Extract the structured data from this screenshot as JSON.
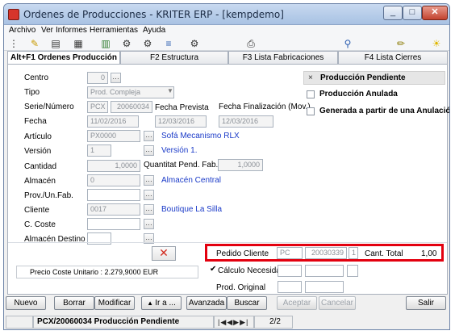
{
  "window": {
    "title": "Ordenes de Producciones - KRITER ERP - [kempdemo]"
  },
  "menu": [
    "Archivo",
    "Ver",
    "Informes",
    "Herramientas",
    "Ayuda"
  ],
  "toolbar_icons": [
    "tree-icon",
    "wand-icon",
    "document-search-icon",
    "calculator-icon",
    "spreadsheet-icon",
    "gear-icon",
    "gear-arrow-icon",
    "list-check-icon",
    "settings-check-icon",
    "printer-icon",
    "paperclip-icon",
    "attachment-icon",
    "lightbulb-icon"
  ],
  "tabs": [
    "Alt+F1 Ordenes Producción",
    "F2 Estructura",
    "F3 Lista Fabricaciones",
    "F4 Lista Cierres"
  ],
  "form": {
    "centro_label": "Centro",
    "centro_value": "0",
    "tipo_label": "Tipo",
    "tipo_value": "Prod. Compleja",
    "serie_label": "Serie/Número",
    "serie_value": "PCX",
    "numero_value": "20060034",
    "fecha_prevista_label": "Fecha Prevista",
    "fecha_finalizacion_label": "Fecha Finalización (Mov.)",
    "fecha_label": "Fecha",
    "fecha_value": "11/02/2016",
    "fecha_prevista_value": "12/03/2016",
    "fecha_finalizacion_value": "12/03/2016",
    "articulo_label": "Artículo",
    "articulo_value": "PX0000",
    "articulo_desc": "Sofá Mecanismo RLX",
    "version_label": "Versión",
    "version_value": "1",
    "version_desc": "Versión 1.",
    "cantidad_label": "Cantidad",
    "cantidad_value": "1,0000",
    "quantitat_label": "Quantitat Pend. Fab.",
    "quantitat_value": "1,0000",
    "almacen_label": "Almacén",
    "almacen_value": "0",
    "almacen_desc": "Almacén Central",
    "prov_label": "Prov./Un.Fab.",
    "cliente_label": "Cliente",
    "cliente_value": "0017",
    "cliente_desc": "Boutique La Silla",
    "coste_label": "C. Coste",
    "almacen_destino_label": "Almacén Destino"
  },
  "status_options": [
    {
      "label": "Producción Pendiente",
      "selected": true
    },
    {
      "label": "Producción Anulada",
      "selected": false
    },
    {
      "label": "Generada a partir de una Anulación",
      "selected": false
    }
  ],
  "bottom": {
    "pedido_label": "Pedido Cliente",
    "pedido_serie": "PC",
    "pedido_numero": "20030339",
    "pedido_linea": "1",
    "cant_total_label": "Cant. Total",
    "cant_total_value": "1,00",
    "precio_coste": "Precio Coste Unitario : 2.279,9000 EUR",
    "calculo_label": "Cálculo Necesidad :",
    "prod_original_label": "Prod. Original"
  },
  "buttons": [
    "Nuevo",
    "Borrar",
    "Modificar",
    "Ir a ...",
    "Avanzada",
    "Buscar",
    "Aceptar",
    "Cancelar",
    "Salir"
  ],
  "statusbar": {
    "record": "PCX/20060034 Producción Pendiente",
    "position": "2/2"
  }
}
